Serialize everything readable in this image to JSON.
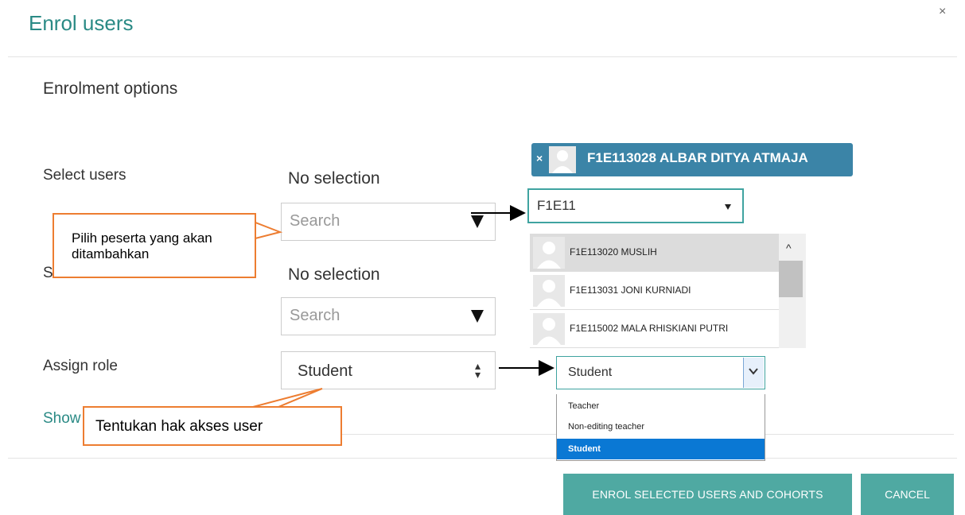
{
  "dialog": {
    "title": "Enrol users",
    "close": "×"
  },
  "section": {
    "title": "Enrolment options"
  },
  "fields": {
    "select_users_label": "Select users",
    "select_users_status": "No selection",
    "select_users_placeholder": "Search",
    "select_cohorts_label_partial": "S",
    "select_cohorts_status": "No selection",
    "select_cohorts_placeholder": "Search",
    "assign_role_label": "Assign role",
    "assign_role_value": "Student",
    "show_more_partial": "Show"
  },
  "callouts": {
    "users": "Pilih peserta yang akan ditambahkan",
    "role": "Tentukan hak akses user"
  },
  "zoom_users": {
    "selected_chip": "F1E113028 ALBAR DITYA ATMAJA",
    "chip_remove": "×",
    "search_value": "F1E11",
    "suggestions": [
      "F1E113020 MUSLIH",
      "F1E113031 JONI KURNIADI",
      "F1E115002 MALA RHISKIANI PUTRI"
    ],
    "scroll_up": "^"
  },
  "zoom_role": {
    "value": "Student",
    "options": [
      "Teacher",
      "Non-editing teacher",
      "Student"
    ],
    "selected": "Student"
  },
  "footer": {
    "enrol_button": "ENROL SELECTED USERS AND COHORTS",
    "cancel_button": "CANCEL"
  },
  "colors": {
    "accent": "#2a8a85",
    "button": "#4fa9a2",
    "chip": "#3b84a7",
    "callout_border": "#ed7d31",
    "selected_option": "#0a78d4"
  }
}
